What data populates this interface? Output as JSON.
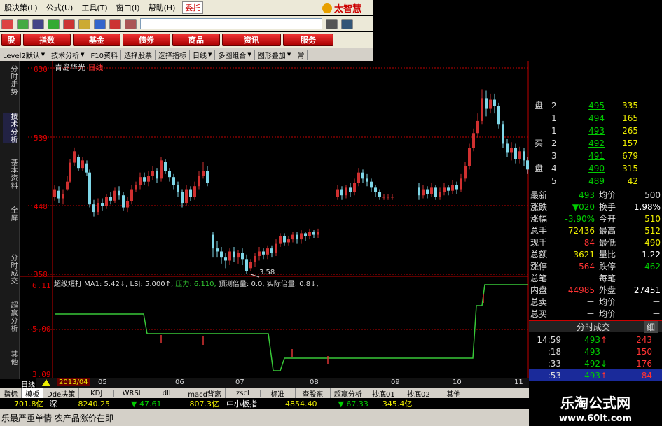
{
  "menu": {
    "items": [
      "股决策(L)",
      "公式(U)",
      "工具(T)",
      "窗口(I)",
      "帮助(H)"
    ],
    "entrust": "委托",
    "brand": "太智慧"
  },
  "rednav": [
    "股",
    "指数",
    "基金",
    "债券",
    "商品",
    "资讯",
    "服务"
  ],
  "subtabs": [
    "Level2默认",
    "技术分析",
    "F10资料",
    "选择股票",
    "选择指标",
    "日线",
    "多图组合",
    "图形叠加",
    "常"
  ],
  "vtabs": [
    "分时走势",
    "技术分析",
    "基本资料",
    "全屏",
    "分时成交",
    "超赢分析",
    "其他"
  ],
  "chart": {
    "stock_name": "青岛华光",
    "period": "日线",
    "y_labels": [
      "630",
      "539",
      "448",
      "358"
    ],
    "low_label": "3.58",
    "indicator_text": "超级短打 MA1: 5.42↓, LSJ: 5.000↑,",
    "pressure_text": "压力: 6.110,",
    "indicator_rest": "预测倍量: 0.0, 实际倍量: 0.8↓,",
    "ind_y_labels": [
      "6.11",
      "5.00",
      "3.09"
    ]
  },
  "orderbook": {
    "sell_label": "盘",
    "buy_label_1": "买",
    "buy_label_2": "盘",
    "sell": [
      {
        "lvl": "2",
        "price": "495",
        "vol": "335"
      },
      {
        "lvl": "1",
        "price": "494",
        "vol": "165"
      }
    ],
    "buy": [
      {
        "lvl": "1",
        "price": "493",
        "vol": "265"
      },
      {
        "lvl": "2",
        "price": "492",
        "vol": "157"
      },
      {
        "lvl": "3",
        "price": "491",
        "vol": "679"
      },
      {
        "lvl": "4",
        "price": "490",
        "vol": "315"
      },
      {
        "lvl": "5",
        "price": "489",
        "vol": "42"
      }
    ]
  },
  "stats": [
    {
      "l1": "最新",
      "v1": "493",
      "l2": "均价",
      "v2": "500"
    },
    {
      "l1": "涨跌",
      "v1": "▼020",
      "l2": "换手",
      "v2": "1.98%"
    },
    {
      "l1": "涨幅",
      "v1": "-3.90%",
      "l2": "今开",
      "v2": "510"
    },
    {
      "l1": "总手",
      "v1": "72436",
      "l2": "最高",
      "v2": "512"
    },
    {
      "l1": "现手",
      "v1": "84",
      "l2": "最低",
      "v2": "490"
    },
    {
      "l1": "总额",
      "v1": "3621",
      "l2": "量比",
      "v2": "1.22"
    },
    {
      "l1": "涨停",
      "v1": "564",
      "l2": "跌停",
      "v2": "462"
    },
    {
      "l1": "总笔",
      "v1": "－",
      "l2": "每笔",
      "v2": "－"
    },
    {
      "l1": "内盘",
      "v1": "44985",
      "l2": "外盘",
      "v2": "27451"
    },
    {
      "l1": "总卖",
      "v1": "－",
      "l2": "均价",
      "v2": "－"
    },
    {
      "l1": "总买",
      "v1": "－",
      "l2": "均价",
      "v2": "－"
    }
  ],
  "trades_tab": "分时成交",
  "trades_tab2": "细",
  "trades": [
    {
      "t": "14:59",
      "p": "493",
      "arrow": "↑",
      "v": "243"
    },
    {
      "t": ":18",
      "p": "493",
      "arrow": "",
      "v": "150"
    },
    {
      "t": ":33",
      "p": "492",
      "arrow": "↓",
      "v": "176"
    },
    {
      "t": ":53",
      "p": "493",
      "arrow": "↑",
      "v": "84"
    }
  ],
  "datebar": {
    "label": "日线",
    "dates": [
      "2013/04",
      "05",
      "06",
      "07",
      "08",
      "09",
      "10",
      "11"
    ]
  },
  "bottabs": [
    "指标",
    "模板",
    "Dde决策",
    "KDJ",
    "WRSI",
    "dll",
    "macd背离",
    "zscl",
    "标准",
    "查股东",
    "超赢分析",
    "抄底01",
    "抄底02",
    "其他"
  ],
  "ticker": [
    {
      "t": "701.8亿",
      "c": "yel"
    },
    {
      "t": "深",
      "c": "wht"
    },
    {
      "t": "8240.25",
      "c": "yel"
    },
    {
      "t": "▼ 47.61",
      "c": "grn"
    },
    {
      "t": "807.3亿",
      "c": "yel"
    },
    {
      "t": "中小板指",
      "c": "wht"
    },
    {
      "t": "4854.40",
      "c": "yel"
    },
    {
      "t": "▼ 67.33",
      "c": "grn"
    },
    {
      "t": "345.4亿",
      "c": "yel"
    }
  ],
  "news": "乐最严重单情  农产品涨价在即",
  "watermark": {
    "line1": "乐淘公式网",
    "line2": "www.60lt.com"
  },
  "colors": {
    "up": "#d03030",
    "down": "#7fd7e8",
    "indicator": "#38c838",
    "axis": "#c00000"
  }
}
